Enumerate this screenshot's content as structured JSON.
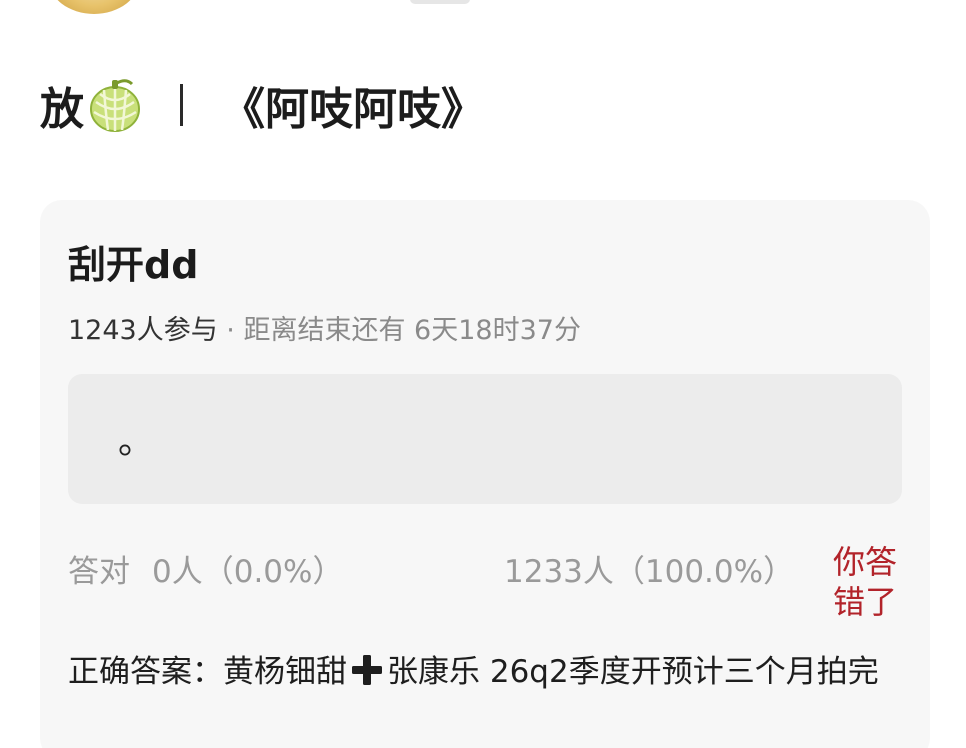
{
  "header": {
    "title_prefix": "放",
    "title_emoji": "melon-icon",
    "title_name": "《阿吱阿吱》"
  },
  "poll": {
    "title": "刮开dd",
    "participants": "1243人参与",
    "separator": " · ",
    "countdown": "距离结束还有 6天18时37分",
    "option_text": "。",
    "stats": {
      "correct_label": "答对",
      "correct_count": "0人（0.0%）",
      "wrong_count": "1233人（100.0%）",
      "wrong_badge": "你答错了"
    },
    "answer_prefix": "正确答案：黄杨钿甜",
    "answer_icon": "plus-icon",
    "answer_suffix": "张康乐 26q2季度开预计三个月拍完"
  },
  "colors": {
    "accent_red": "#b2232a",
    "card_bg": "#f7f7f7",
    "option_bg": "#ececec",
    "muted_text": "#9a9a9a"
  }
}
